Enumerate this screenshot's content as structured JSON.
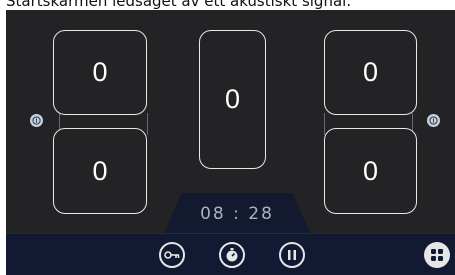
{
  "caption": "Startskärmen ledsaget av ett akustiskt signal.",
  "zones": {
    "left_top": "0",
    "left_bottom": "0",
    "center": "0",
    "right_top": "0",
    "right_bottom": "0"
  },
  "timer": "08 : 28",
  "icons": {
    "left_side": "bridge-toggle-icon",
    "right_side": "bridge-toggle-icon",
    "key": "key-lock-icon",
    "timer": "timer-icon",
    "pause": "pause-icon",
    "menu": "menu-grid-icon"
  },
  "colors": {
    "panel": "#232326",
    "bar": "#121a33",
    "timer_text": "#a9b3c2"
  }
}
